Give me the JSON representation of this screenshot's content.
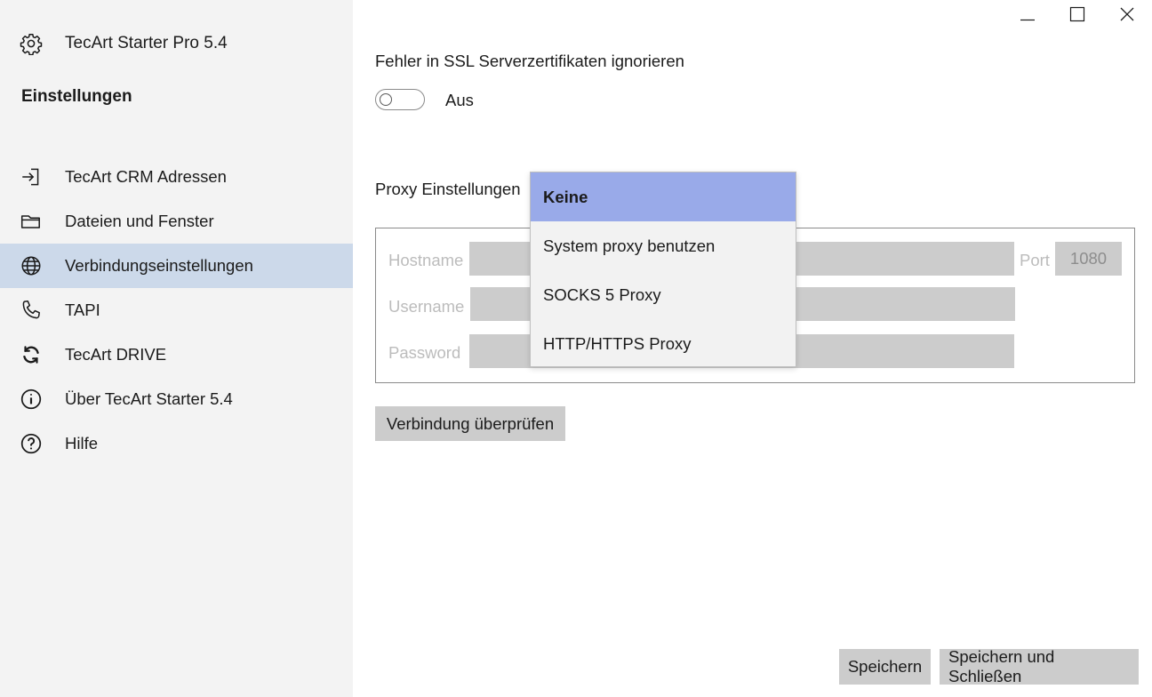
{
  "window": {
    "minimize_icon": "minimize-icon",
    "maximize_icon": "maximize-icon",
    "close_icon": "close-icon"
  },
  "sidebar": {
    "app_title": "TecArt Starter Pro 5.4",
    "app_icon": "gear-icon",
    "section_heading": "Einstellungen",
    "items": [
      {
        "label": "TecArt CRM Adressen",
        "icon": "sign-in-icon",
        "active": false
      },
      {
        "label": "Dateien und Fenster",
        "icon": "folder-icon",
        "active": false
      },
      {
        "label": "Verbindungseinstellungen",
        "icon": "globe-icon",
        "active": true
      },
      {
        "label": "TAPI",
        "icon": "phone-icon",
        "active": false
      },
      {
        "label": "TecArt DRIVE",
        "icon": "sync-icon",
        "active": false
      },
      {
        "label": "Über TecArt Starter 5.4",
        "icon": "info-icon",
        "active": false
      },
      {
        "label": "Hilfe",
        "icon": "help-icon",
        "active": false
      }
    ]
  },
  "ssl": {
    "label": "Fehler in SSL Serverzertifikaten ignorieren",
    "toggle_state": "Aus",
    "enabled": false
  },
  "proxy": {
    "label": "Proxy Einstellungen",
    "dropdown": {
      "selected": "Keine",
      "options": [
        "Keine",
        "System proxy benutzen",
        "SOCKS 5 Proxy",
        "HTTP/HTTPS Proxy"
      ]
    },
    "fields": {
      "hostname_label": "Hostname",
      "port_label": "Port",
      "port_value": "1080",
      "username_label": "Username",
      "password_label": "Password"
    }
  },
  "buttons": {
    "check_connection": "Verbindung überprüfen",
    "save": "Speichern",
    "save_close": "Speichern und Schließen"
  },
  "colors": {
    "sidebar_bg": "#f3f3f3",
    "active_item_bg": "#ccd9ea",
    "dropdown_selected_bg": "#99aae9",
    "button_bg": "#cccccc"
  }
}
